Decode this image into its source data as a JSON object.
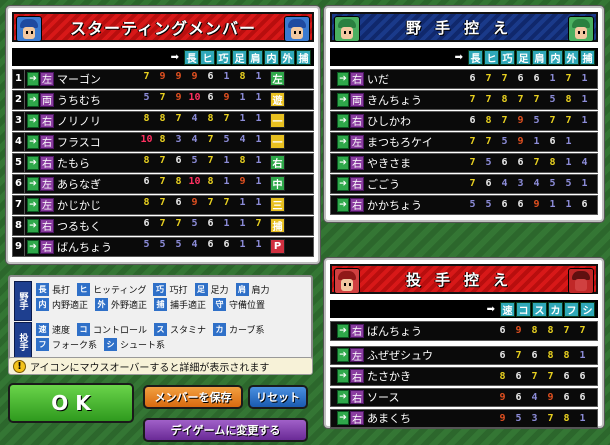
{
  "starting": {
    "title": "スターティングメンバー",
    "legend_arrow": "➡",
    "header_labels": [
      "長",
      "ヒ",
      "巧",
      "足",
      "肩",
      "内",
      "外",
      "捕"
    ],
    "rows": [
      {
        "num": "1",
        "hand": "左",
        "name": "マーゴン",
        "stats": [
          "7",
          "9",
          "9",
          "9",
          "6",
          "1",
          "8",
          "1"
        ],
        "pos": "左"
      },
      {
        "num": "2",
        "hand": "両",
        "name": "うちむち",
        "stats": [
          "5",
          "7",
          "9",
          "10",
          "6",
          "9",
          "1",
          "1"
        ],
        "pos": "遊"
      },
      {
        "num": "3",
        "hand": "右",
        "name": "ノリノリ",
        "stats": [
          "8",
          "8",
          "7",
          "4",
          "8",
          "7",
          "1",
          "1"
        ],
        "pos": "一"
      },
      {
        "num": "4",
        "hand": "右",
        "name": "フラスコ",
        "stats": [
          "10",
          "8",
          "3",
          "4",
          "7",
          "5",
          "4",
          "1"
        ],
        "pos": "一"
      },
      {
        "num": "5",
        "hand": "右",
        "name": "たもら",
        "stats": [
          "8",
          "7",
          "6",
          "5",
          "7",
          "1",
          "8",
          "1"
        ],
        "pos": "右"
      },
      {
        "num": "6",
        "hand": "左",
        "name": "あらなぎ",
        "stats": [
          "6",
          "7",
          "8",
          "10",
          "8",
          "1",
          "9",
          "1"
        ],
        "pos": "中"
      },
      {
        "num": "7",
        "hand": "左",
        "name": "かじかじ",
        "stats": [
          "8",
          "7",
          "6",
          "9",
          "7",
          "7",
          "1",
          "1"
        ],
        "pos": "三"
      },
      {
        "num": "8",
        "hand": "右",
        "name": "つるもく",
        "stats": [
          "6",
          "7",
          "7",
          "5",
          "6",
          "1",
          "1",
          "7"
        ],
        "pos": "捕"
      },
      {
        "num": "9",
        "hand": "右",
        "name": "ばんちょう",
        "stats": [
          "5",
          "5",
          "5",
          "4",
          "6",
          "6",
          "1",
          "1"
        ],
        "pos": "P"
      }
    ]
  },
  "bench_fielders": {
    "title": "野手控え",
    "legend_arrow": "➡",
    "header_labels": [
      "長",
      "ヒ",
      "巧",
      "足",
      "肩",
      "内",
      "外",
      "捕"
    ],
    "rows": [
      {
        "hand": "右",
        "name": "いだ",
        "stats": [
          "6",
          "7",
          "7",
          "6",
          "6",
          "1",
          "7",
          "1"
        ]
      },
      {
        "hand": "両",
        "name": "きんちょう",
        "stats": [
          "7",
          "7",
          "8",
          "7",
          "7",
          "5",
          "8",
          "1"
        ]
      },
      {
        "hand": "右",
        "name": "ひしかわ",
        "stats": [
          "6",
          "8",
          "7",
          "9",
          "5",
          "7",
          "7",
          "1"
        ]
      },
      {
        "hand": "左",
        "name": "まつもろケイ",
        "stats": [
          "7",
          "7",
          "5",
          "9",
          "1",
          "6",
          "1"
        ]
      },
      {
        "hand": "右",
        "name": "やきさま",
        "stats": [
          "7",
          "5",
          "6",
          "6",
          "7",
          "8",
          "1",
          "4"
        ]
      },
      {
        "hand": "右",
        "name": "ごごう",
        "stats": [
          "7",
          "6",
          "4",
          "3",
          "4",
          "5",
          "5",
          "1"
        ]
      },
      {
        "hand": "右",
        "name": "かかちょう",
        "stats": [
          "5",
          "5",
          "6",
          "6",
          "9",
          "1",
          "1",
          "6"
        ]
      }
    ]
  },
  "bench_pitchers": {
    "title": "投手控え",
    "legend_arrow": "➡",
    "header_labels": [
      "速",
      "コ",
      "ス",
      "カ",
      "フ",
      "シ"
    ],
    "rows": [
      {
        "hand": "右",
        "name": "ばんちょう",
        "stats": [
          "6",
          "9",
          "8",
          "8",
          "7",
          "7"
        ]
      },
      {
        "hand": "左",
        "name": "ふぜぜシュウ",
        "stats": [
          "6",
          "7",
          "6",
          "8",
          "8",
          "1"
        ]
      },
      {
        "hand": "右",
        "name": "たさかき",
        "stats": [
          "8",
          "6",
          "7",
          "7",
          "6",
          "6"
        ]
      },
      {
        "hand": "右",
        "name": "ソース",
        "stats": [
          "9",
          "6",
          "4",
          "9",
          "6",
          "6"
        ]
      },
      {
        "hand": "右",
        "name": "あまくち",
        "stats": [
          "9",
          "5",
          "3",
          "7",
          "8",
          "1"
        ]
      }
    ]
  },
  "legend": {
    "fielder_cat": "野手",
    "pitcher_cat": "投手",
    "items_fielder": [
      {
        "key": "長",
        "desc": "長打"
      },
      {
        "key": "ヒ",
        "desc": "ヒッティング"
      },
      {
        "key": "巧",
        "desc": "巧打"
      },
      {
        "key": "足",
        "desc": "足力"
      },
      {
        "key": "肩",
        "desc": "肩力"
      },
      {
        "key": "内",
        "desc": "内野適正"
      },
      {
        "key": "外",
        "desc": "外野適正"
      },
      {
        "key": "捕",
        "desc": "捕手適正"
      },
      {
        "key": "守",
        "desc": "守備位置"
      }
    ],
    "items_pitcher": [
      {
        "key": "速",
        "desc": "速度"
      },
      {
        "key": "コ",
        "desc": "コントロール"
      },
      {
        "key": "ス",
        "desc": "スタミナ"
      },
      {
        "key": "カ",
        "desc": "カーブ系"
      },
      {
        "key": "フ",
        "desc": "フォーク系"
      },
      {
        "key": "シ",
        "desc": "シュート系"
      }
    ]
  },
  "note": "アイコンにマウスオーバーすると詳細が表示されます",
  "buttons": {
    "ok": "O K",
    "save": "メンバーを保存",
    "reset": "リセット",
    "dayGame": "デイゲームに変更する"
  },
  "colors": {
    "stat_low": "#8c8cd8",
    "stat_mid": "#e8e8e8",
    "stat_good": "#e8d020",
    "stat_high": "#e05020",
    "stat_max": "#ff3060",
    "pos_yellow": "#e8c020",
    "pos_green": "#2fa84a",
    "pos_p": "#d03040"
  }
}
